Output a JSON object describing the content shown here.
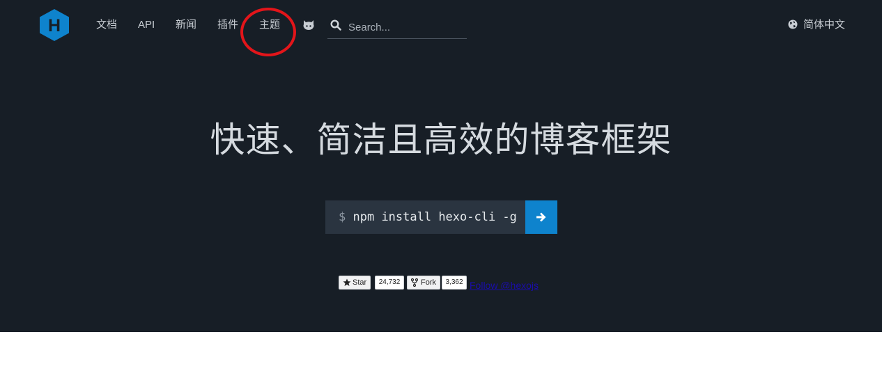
{
  "header": {
    "logo_letter": "H",
    "nav": [
      "文档",
      "API",
      "新闻",
      "插件",
      "主题"
    ],
    "search_placeholder": "Search...",
    "language": "简体中文"
  },
  "hero": {
    "title": "快速、简洁且高效的博客框架",
    "install_prompt": "$",
    "install_command": "npm install hexo-cli -g"
  },
  "github": {
    "star_label": "Star",
    "star_count": "24,732",
    "fork_label": "Fork",
    "fork_count": "3,362",
    "follow_label": "Follow @hexojs"
  },
  "colors": {
    "hero_bg": "#171e26",
    "accent": "#0e83cd",
    "annotation": "#e3151a"
  }
}
